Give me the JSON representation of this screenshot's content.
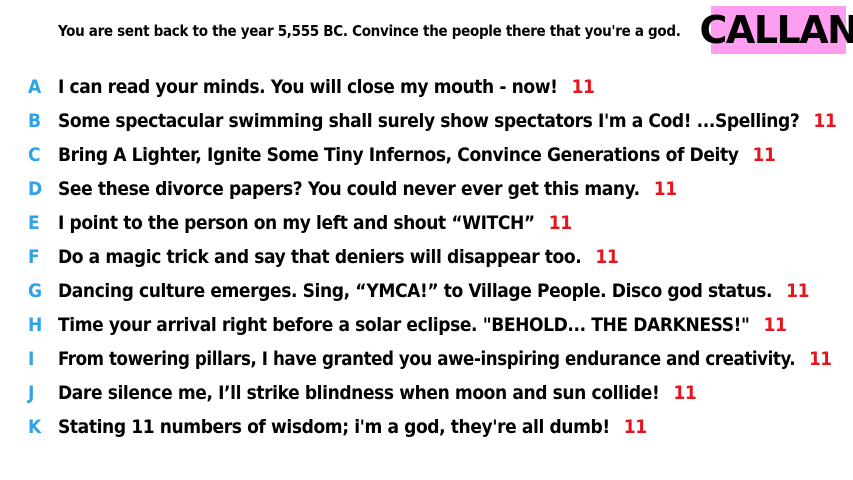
{
  "question": "You are sent back to the year 5,555 BC. Convince the people there that you're a god.",
  "logo_text": "CALLAN",
  "colors": {
    "letter": "#2ea3e6",
    "score": "#e8141c",
    "logo_bg": "#ff9ef0"
  },
  "answers": [
    {
      "letter": "A",
      "text": "I can read your minds. You will close my mouth - now!",
      "score": "11"
    },
    {
      "letter": "B",
      "text": "Some spectacular swimming shall surely show spectators I'm a Cod! ...Spelling?",
      "score": "11"
    },
    {
      "letter": "C",
      "text": "Bring A Lighter, Ignite Some Tiny Infernos, Convince Generations of Deity",
      "score": "11"
    },
    {
      "letter": "D",
      "text": "See these divorce papers? You could never ever get this many.",
      "score": "11"
    },
    {
      "letter": "E",
      "text": "I point to the person on my left and shout “WITCH”",
      "score": "11"
    },
    {
      "letter": "F",
      "text": "Do a magic trick and say that deniers will disappear too.",
      "score": "11"
    },
    {
      "letter": "G",
      "text": "Dancing culture emerges. Sing, “YMCA!” to Village People. Disco god status.",
      "score": "11"
    },
    {
      "letter": "H",
      "text": "Time your arrival right before a solar eclipse. \"BEHOLD... THE DARKNESS!\"",
      "score": "11"
    },
    {
      "letter": "I",
      "text": "From towering pillars, I have granted you awe-inspiring endurance and creativity.",
      "score": "11"
    },
    {
      "letter": "J",
      "text": "Dare silence me, I’ll strike blindness when moon and sun collide!",
      "score": "11"
    },
    {
      "letter": "K",
      "text": "Stating 11 numbers of wisdom; i'm a god, they're all dumb!",
      "score": "11"
    }
  ]
}
